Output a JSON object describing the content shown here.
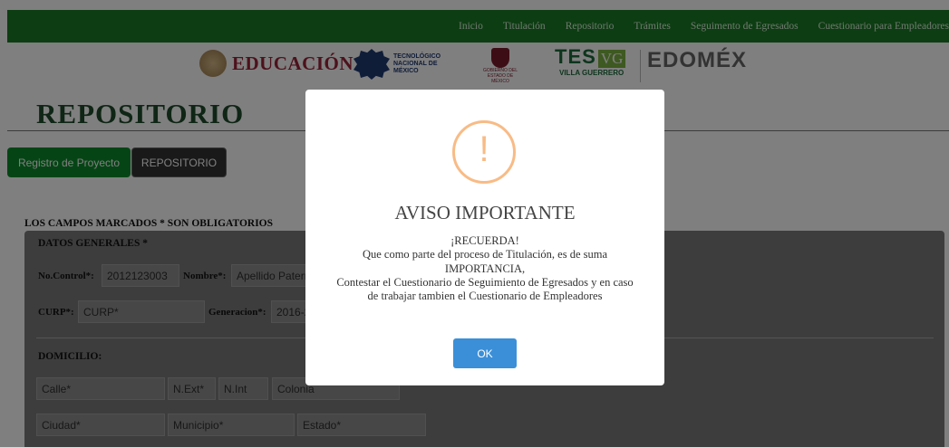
{
  "nav": {
    "items": [
      "Inicio",
      "Titulación",
      "Repositorio",
      "Trámites",
      "Seguimento de Egresados",
      "Cuestionario para Empleadores"
    ]
  },
  "logos": {
    "educacion": "EDUCACIÓN",
    "tecnm": "TECNOLÓGICO NACIONAL DE MÉXICO",
    "gobierno": "GOBIERNO DEL ESTADO DE MÉXICO",
    "tes": "TES",
    "vg": "VG",
    "villa_guerrero": "VILLA GUERRERO",
    "edomex": "EDOMÉX"
  },
  "page": {
    "title": "REPOSITORIO",
    "tabs": [
      "Registro de Proyecto",
      "REPOSITORIO"
    ],
    "required_note": "LOS CAMPOS MARCADOS * SON OBLIGATORIOS"
  },
  "form": {
    "datos_generales": "DATOS GENERALES *",
    "no_control_label": "No.Control*:",
    "no_control_value": "2012123003",
    "nombre_label": "Nombre*:",
    "nombre_placeholder": "Apellido Paterno",
    "curp_label": "CURP*:",
    "curp_placeholder": "CURP*",
    "generacion_label": "Generacion*:",
    "generacion_value": "2016-2",
    "domicilio": "DOMICILIO:",
    "calle_placeholder": "Calle*",
    "next_placeholder": "N.Ext*",
    "nint_placeholder": "N.Int",
    "colonia_placeholder": "Colonia",
    "ciudad_placeholder": "Ciudad*",
    "municipio_placeholder": "Municipio*",
    "estado_placeholder": "Estado*"
  },
  "modal": {
    "icon": "warning-icon",
    "icon_glyph": "!",
    "icon_color": "#f8bb86",
    "title": "AVISO IMPORTANTE",
    "lines": [
      "¡RECUERDA!",
      "Que como parte del proceso de Titulación, es de suma IMPORTANCIA,",
      "Contestar el Cuestionario de Seguimiento de Egresados y en caso de trabajar tambien el Cuestionario de Empleadores"
    ],
    "ok_label": "OK",
    "ok_color": "#3b8fd8"
  },
  "colors": {
    "nav_green": "#1a7a24",
    "title_green": "#1e4b2a",
    "tab_green": "#0a8a2a",
    "tab_dark": "#333333"
  }
}
